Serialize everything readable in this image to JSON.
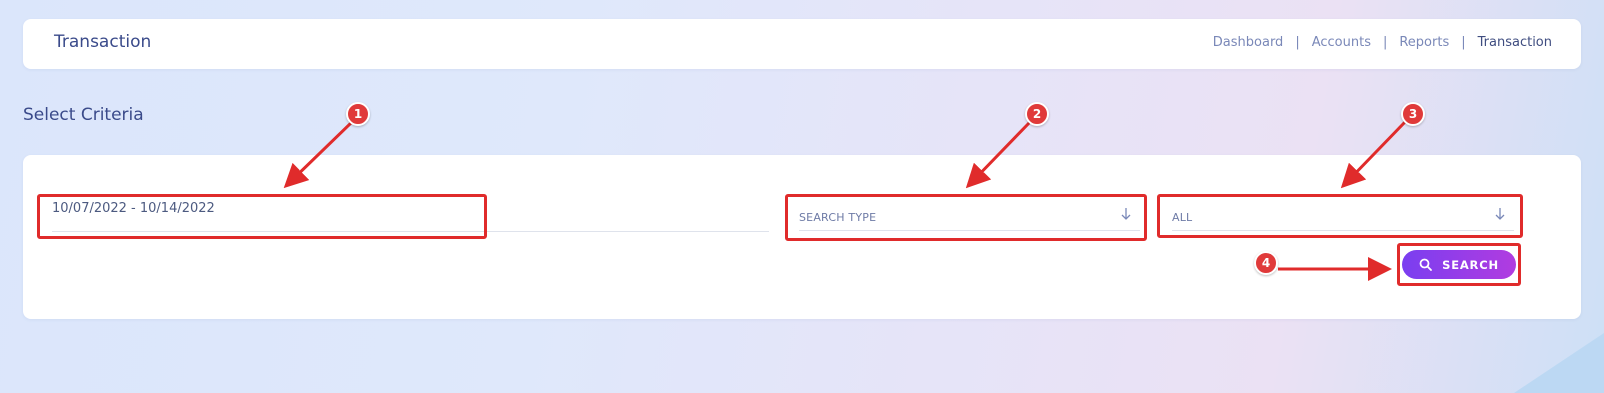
{
  "header": {
    "title": "Transaction",
    "breadcrumb": [
      "Dashboard",
      "Accounts",
      "Reports",
      "Transaction"
    ],
    "separator": "|"
  },
  "criteria": {
    "title": "Select Criteria",
    "date_range": "10/07/2022 - 10/14/2022",
    "search_type": "SEARCH TYPE",
    "all": "ALL",
    "search_button": "SEARCH"
  },
  "annotations": {
    "badges": [
      "1",
      "2",
      "3",
      "4"
    ],
    "color": "#e02b2b"
  },
  "colors": {
    "accent_start": "#7a3ef0",
    "accent_end": "#b13ce0",
    "title": "#3a4a8a"
  },
  "icons": {
    "search": "search-icon",
    "dropdown": "arrow-down-icon"
  }
}
